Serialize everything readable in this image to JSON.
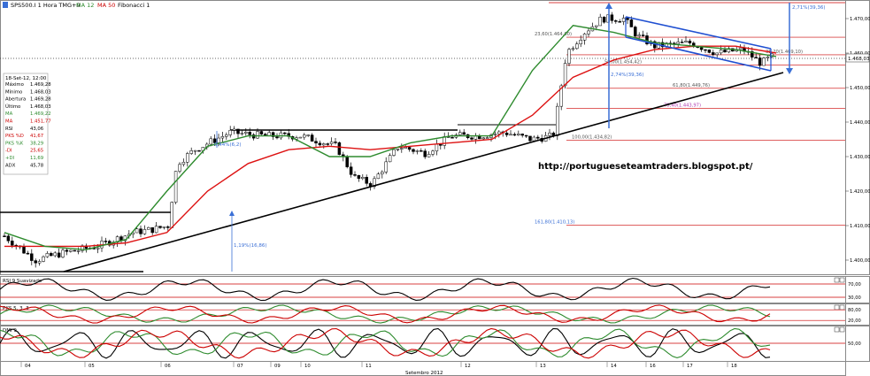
{
  "header": {
    "symbol": "SPS500.I 1 Hora TMG+0",
    "ma12": "MA 12",
    "ma50": "MA 50",
    "fib": "Fibonacci 1"
  },
  "info_box": {
    "date": "18-Set-12, 12:00",
    "rows": [
      {
        "label": "Máximo",
        "value": "1.469,28",
        "color": "#000000"
      },
      {
        "label": "Mínimo",
        "value": "1.468,03",
        "color": "#000000"
      },
      {
        "label": "Abertura",
        "value": "1.469,28",
        "color": "#000000"
      },
      {
        "label": "Último",
        "value": "1.468,03",
        "color": "#000000"
      },
      {
        "label": "MA",
        "value": "1.469,22",
        "color": "#2e8b2e"
      },
      {
        "label": "MA",
        "value": "1.451,77",
        "color": "#cc0000"
      },
      {
        "label": "RSI",
        "value": "43,06",
        "color": "#000000"
      },
      {
        "label": "PKS %D",
        "value": "41,67",
        "color": "#cc0000"
      },
      {
        "label": "PKS %K",
        "value": "38,29",
        "color": "#2e8b2e"
      },
      {
        "label": "-DI",
        "value": "25,65",
        "color": "#cc0000"
      },
      {
        "label": "+DI",
        "value": "11,69",
        "color": "#2e8b2e"
      },
      {
        "label": "ADX",
        "value": "45,78",
        "color": "#000000"
      }
    ]
  },
  "url_text": "http://portugueseteamtraders.blogspot.pt/",
  "y_ticks": [
    "1.470,00",
    "1.460,00",
    "1.450,00",
    "1.440,00",
    "1.430,00",
    "1.420,00",
    "1.410,00",
    "1.400,00"
  ],
  "current_price": "1.468,03",
  "fib_labels": [
    {
      "text": "23,60(1.464,60)",
      "value": 1464.6
    },
    {
      "text": "38,20(1.469,10)",
      "value": 1459.5
    },
    {
      "text": "50,00(1.454,42)",
      "value": 1456.5
    },
    {
      "text": "61,80(1.449,76)",
      "value": 1449.8
    },
    {
      "text": "78,40(1.443,97)",
      "value": 1444.0
    },
    {
      "text": "100,00(1.434,82)",
      "value": 1434.8
    },
    {
      "text": "161,80(1.410,13)",
      "value": 1410.1
    }
  ],
  "measure_labels": {
    "big_up": "2,71%(39,36)",
    "mid_up": "2,74%(39,36)",
    "small_up": "1,19%(16,86)",
    "small_label": "0,44%(6,2)"
  },
  "sub_panels": [
    {
      "name": "RSI 9 Suavizado",
      "ticks": [
        "70,00",
        "30,00"
      ]
    },
    {
      "name": "PKS 5, 3, 3",
      "ticks": [
        "80,00",
        "20,00"
      ]
    },
    {
      "name": "DMI 9",
      "ticks": [
        "50,00"
      ]
    }
  ],
  "x_day_labels": [
    "04",
    "05",
    "06",
    "07",
    "09",
    "10",
    "11",
    "12",
    "13",
    "14",
    "16",
    "17",
    "18"
  ],
  "x_axis_title": "Setembro 2012",
  "colors": {
    "ma12": "#2e8b2e",
    "ma50": "#dd1111",
    "channel": "#1f4fd1",
    "trend": "#000000",
    "fib": "#cc0000"
  },
  "chart_data": {
    "type": "candlestick",
    "title": "SPS500.I 1 Hora",
    "ylim": [
      1393,
      1478
    ],
    "x_categories": [
      "04",
      "05",
      "06",
      "07",
      "09",
      "10",
      "11",
      "12",
      "13",
      "14",
      "16",
      "17",
      "18"
    ],
    "series": [
      {
        "name": "MA 12",
        "points": [
          [
            0,
            1408
          ],
          [
            2,
            1404
          ],
          [
            4,
            1403
          ],
          [
            6,
            1406
          ],
          [
            8,
            1420
          ],
          [
            10,
            1433
          ],
          [
            12,
            1436
          ],
          [
            14,
            1436
          ],
          [
            16,
            1430
          ],
          [
            18,
            1430
          ],
          [
            20,
            1434
          ],
          [
            22,
            1436
          ],
          [
            24,
            1436
          ],
          [
            26,
            1455
          ],
          [
            28,
            1468
          ],
          [
            30,
            1466
          ],
          [
            32,
            1463
          ],
          [
            34,
            1462
          ],
          [
            36,
            1461
          ],
          [
            38,
            1459
          ]
        ]
      },
      {
        "name": "MA 50",
        "points": [
          [
            0,
            1404
          ],
          [
            2,
            1404
          ],
          [
            4,
            1404
          ],
          [
            6,
            1405
          ],
          [
            8,
            1408
          ],
          [
            10,
            1420
          ],
          [
            12,
            1428
          ],
          [
            14,
            1432
          ],
          [
            16,
            1433
          ],
          [
            18,
            1432
          ],
          [
            20,
            1433
          ],
          [
            22,
            1434
          ],
          [
            24,
            1435
          ],
          [
            26,
            1442
          ],
          [
            28,
            1453
          ],
          [
            30,
            1458
          ],
          [
            32,
            1461
          ],
          [
            34,
            1462
          ],
          [
            36,
            1462
          ],
          [
            38,
            1460
          ]
        ]
      }
    ],
    "last_close": 1468.03,
    "ma12_last": 1469.22,
    "ma50_last": 1451.77
  }
}
